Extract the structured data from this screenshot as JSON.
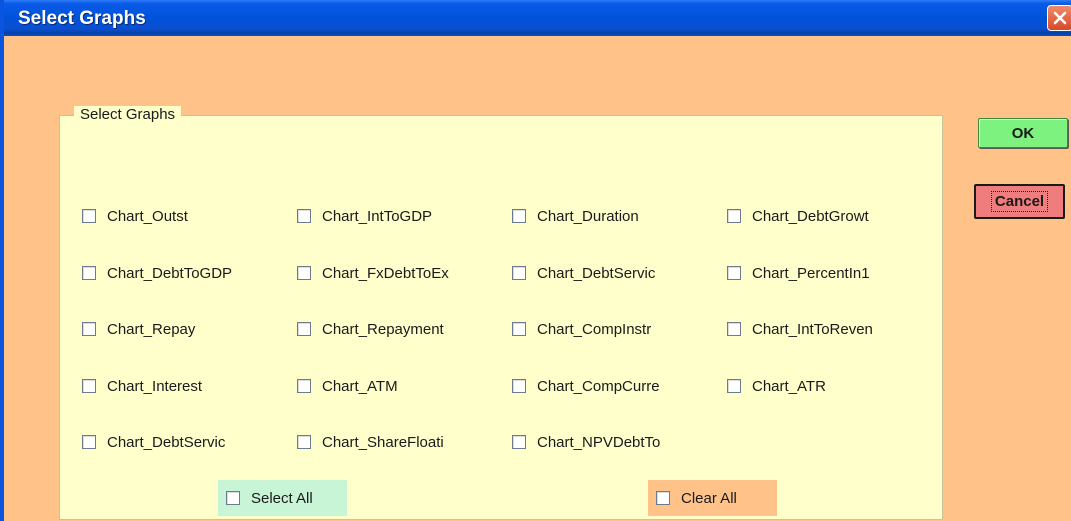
{
  "window": {
    "title": "Select Graphs"
  },
  "group": {
    "legend": "Select Graphs"
  },
  "checkboxes": [
    {
      "label": "Chart_Outst",
      "checked": false
    },
    {
      "label": "Chart_IntToGDP",
      "checked": false
    },
    {
      "label": "Chart_Duration",
      "checked": false
    },
    {
      "label": "Chart_DebtGrowt",
      "checked": false
    },
    {
      "label": "Chart_DebtToGDP",
      "checked": false
    },
    {
      "label": "Chart_FxDebtToEx",
      "checked": false
    },
    {
      "label": "Chart_DebtServic",
      "checked": false
    },
    {
      "label": "Chart_PercentIn1",
      "checked": false
    },
    {
      "label": "Chart_Repay",
      "checked": false
    },
    {
      "label": "Chart_Repayment",
      "checked": false
    },
    {
      "label": "Chart_CompInstr",
      "checked": false
    },
    {
      "label": "Chart_IntToReven",
      "checked": false
    },
    {
      "label": "Chart_Interest",
      "checked": false
    },
    {
      "label": "Chart_ATM",
      "checked": false
    },
    {
      "label": "Chart_CompCurre",
      "checked": false
    },
    {
      "label": "Chart_ATR",
      "checked": false
    },
    {
      "label": "Chart_DebtServic",
      "checked": false
    },
    {
      "label": "Chart_ShareFloati",
      "checked": false
    },
    {
      "label": "Chart_NPVDebtTo",
      "checked": false
    }
  ],
  "controls": {
    "select_all_label": "Select All",
    "clear_all_label": "Clear All",
    "ok_label": "OK",
    "cancel_label": "Cancel"
  },
  "colors": {
    "dialog_background": "#ffc38a",
    "group_background": "#ffffcc",
    "ok_button": "#7ef27e",
    "cancel_button": "#f07d7d",
    "select_all_background": "#c8f5d6",
    "title_bar": "#0052d8"
  },
  "icons": {
    "close": "close-x-icon"
  }
}
